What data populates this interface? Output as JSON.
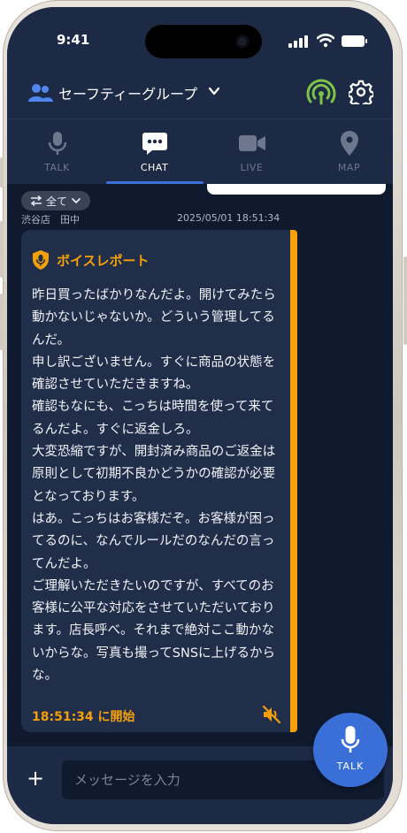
{
  "status": {
    "time": "9:41"
  },
  "header": {
    "group_name": "セーフティーグループ"
  },
  "tabs": [
    {
      "label": "TALK",
      "icon": "mic-icon"
    },
    {
      "label": "CHAT",
      "icon": "chat-icon"
    },
    {
      "label": "LIVE",
      "icon": "video-icon"
    },
    {
      "label": "MAP",
      "icon": "pin-icon"
    }
  ],
  "chat": {
    "filter_label": "全て",
    "sender": "渋谷店　田中",
    "timestamp": "2025/05/01 18:51:34",
    "voice_report": {
      "title": "ボイスレポート",
      "lines": [
        "昨日買ったばかりなんだよ。開けてみたら動かないじゃないか。どういう管理してるんだ。",
        "申し訳ございません。すぐに商品の状態を確認させていただきますね。",
        "確認もなにも、こっちは時間を使って来てるんだよ。すぐに返金しろ。",
        "大変恐縮ですが、開封済み商品のご返金は原則として初期不良かどうかの確認が必要となっております。",
        "はあ。こっちはお客様だぞ。お客様が困ってるのに、なんでルールだのなんだの言ってんだよ。",
        "ご理解いただきたいのですが、すべてのお客様に公平な対応をさせていただいております。店長呼べ。それまで絶対ここ動かないからな。写真も撮ってSNSに上げるからな。"
      ],
      "start_time": "18:51:34",
      "start_suffix": " に開始"
    }
  },
  "fab": {
    "label": "TALK"
  },
  "input": {
    "placeholder": "メッセージを入力",
    "add_label": "+"
  },
  "colors": {
    "accent": "#3a6fd8",
    "report": "#f5a00b",
    "bg": "#0f1a2e",
    "bar": "#1d2a45"
  }
}
